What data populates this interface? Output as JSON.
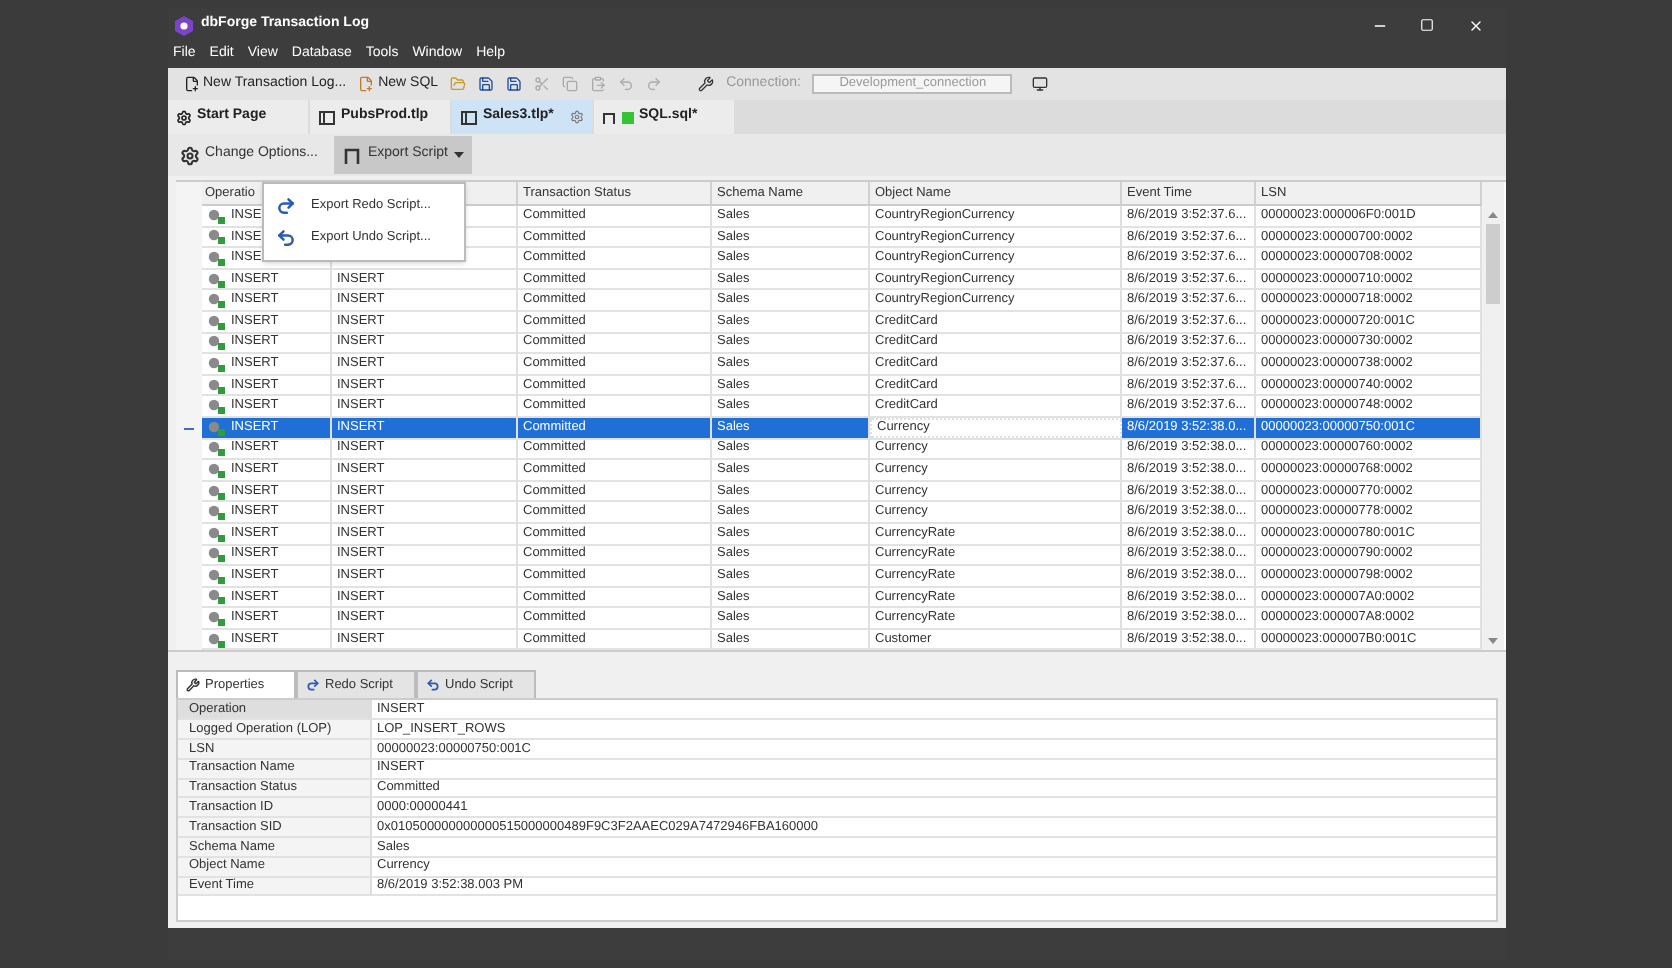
{
  "window": {
    "title": "dbForge Transaction Log"
  },
  "menu": [
    "File",
    "Edit",
    "View",
    "Database",
    "Tools",
    "Window",
    "Help"
  ],
  "toolbar": {
    "new_log": "New Transaction Log...",
    "new_sql": "New SQL",
    "connection_label": "Connection:",
    "connection_value": "Development_connection"
  },
  "document_tabs": [
    {
      "label": "Start Page",
      "kind": "start",
      "selected": false
    },
    {
      "label": "PubsProd.tlp",
      "kind": "log",
      "selected": false
    },
    {
      "label": "Sales3.tlp*",
      "kind": "log",
      "selected": true
    },
    {
      "label": "SQL.sql*",
      "kind": "sql",
      "selected": false
    }
  ],
  "log_toolbar": {
    "change_options": "Change Options...",
    "export_script": "Export Script",
    "export_open": true
  },
  "export_menu": [
    {
      "label": "Export Redo Script...",
      "kind": "redo"
    },
    {
      "label": "Export Undo Script...",
      "kind": "undo"
    }
  ],
  "columns": [
    "Operatio",
    "Transaction Status",
    "Schema Name",
    "Object Name",
    "Event Time",
    "LSN"
  ],
  "rows": [
    {
      "operation": "INSE",
      "status": "Committed",
      "schema": "Sales",
      "object": "CountryRegionCurrency",
      "time": "8/6/2019 3:52:37.6...",
      "lsn": "00000023:000006F0:001D",
      "selected": false
    },
    {
      "operation": "INSE",
      "status": "Committed",
      "schema": "Sales",
      "object": "CountryRegionCurrency",
      "time": "8/6/2019 3:52:37.6...",
      "lsn": "00000023:00000700:0002",
      "selected": false
    },
    {
      "operation": "INSE",
      "status": "Committed",
      "schema": "Sales",
      "object": "CountryRegionCurrency",
      "time": "8/6/2019 3:52:37.6...",
      "lsn": "00000023:00000708:0002",
      "selected": false
    },
    {
      "operation": "INSERT",
      "column_2": "INSERT",
      "status": "Committed",
      "schema": "Sales",
      "object": "CountryRegionCurrency",
      "time": "8/6/2019 3:52:37.6...",
      "lsn": "00000023:00000710:0002",
      "selected": false
    },
    {
      "operation": "INSERT",
      "column_2": "INSERT",
      "status": "Committed",
      "schema": "Sales",
      "object": "CountryRegionCurrency",
      "time": "8/6/2019 3:52:37.6...",
      "lsn": "00000023:00000718:0002",
      "selected": false
    },
    {
      "operation": "INSERT",
      "column_2": "INSERT",
      "status": "Committed",
      "schema": "Sales",
      "object": "CreditCard",
      "time": "8/6/2019 3:52:37.6...",
      "lsn": "00000023:00000720:001C",
      "selected": false
    },
    {
      "operation": "INSERT",
      "column_2": "INSERT",
      "status": "Committed",
      "schema": "Sales",
      "object": "CreditCard",
      "time": "8/6/2019 3:52:37.6...",
      "lsn": "00000023:00000730:0002",
      "selected": false
    },
    {
      "operation": "INSERT",
      "column_2": "INSERT",
      "status": "Committed",
      "schema": "Sales",
      "object": "CreditCard",
      "time": "8/6/2019 3:52:37.6...",
      "lsn": "00000023:00000738:0002",
      "selected": false
    },
    {
      "operation": "INSERT",
      "column_2": "INSERT",
      "status": "Committed",
      "schema": "Sales",
      "object": "CreditCard",
      "time": "8/6/2019 3:52:37.6...",
      "lsn": "00000023:00000740:0002",
      "selected": false
    },
    {
      "operation": "INSERT",
      "column_2": "INSERT",
      "status": "Committed",
      "schema": "Sales",
      "object": "CreditCard",
      "time": "8/6/2019 3:52:37.6...",
      "lsn": "00000023:00000748:0002",
      "selected": false
    },
    {
      "operation": "INSERT",
      "column_2": "INSERT",
      "status": "Committed",
      "schema": "Sales",
      "object": "Currency",
      "time": "8/6/2019 3:52:38.0...",
      "lsn": "00000023:00000750:001C",
      "selected": true
    },
    {
      "operation": "INSERT",
      "column_2": "INSERT",
      "status": "Committed",
      "schema": "Sales",
      "object": "Currency",
      "time": "8/6/2019 3:52:38.0...",
      "lsn": "00000023:00000760:0002",
      "selected": false
    },
    {
      "operation": "INSERT",
      "column_2": "INSERT",
      "status": "Committed",
      "schema": "Sales",
      "object": "Currency",
      "time": "8/6/2019 3:52:38.0...",
      "lsn": "00000023:00000768:0002",
      "selected": false
    },
    {
      "operation": "INSERT",
      "column_2": "INSERT",
      "status": "Committed",
      "schema": "Sales",
      "object": "Currency",
      "time": "8/6/2019 3:52:38.0...",
      "lsn": "00000023:00000770:0002",
      "selected": false
    },
    {
      "operation": "INSERT",
      "column_2": "INSERT",
      "status": "Committed",
      "schema": "Sales",
      "object": "Currency",
      "time": "8/6/2019 3:52:38.0...",
      "lsn": "00000023:00000778:0002",
      "selected": false
    },
    {
      "operation": "INSERT",
      "column_2": "INSERT",
      "status": "Committed",
      "schema": "Sales",
      "object": "CurrencyRate",
      "time": "8/6/2019 3:52:38.0...",
      "lsn": "00000023:00000780:001C",
      "selected": false
    },
    {
      "operation": "INSERT",
      "column_2": "INSERT",
      "status": "Committed",
      "schema": "Sales",
      "object": "CurrencyRate",
      "time": "8/6/2019 3:52:38.0...",
      "lsn": "00000023:00000790:0002",
      "selected": false
    },
    {
      "operation": "INSERT",
      "column_2": "INSERT",
      "status": "Committed",
      "schema": "Sales",
      "object": "CurrencyRate",
      "time": "8/6/2019 3:52:38.0...",
      "lsn": "00000023:00000798:0002",
      "selected": false
    },
    {
      "operation": "INSERT",
      "column_2": "INSERT",
      "status": "Committed",
      "schema": "Sales",
      "object": "CurrencyRate",
      "time": "8/6/2019 3:52:38.0...",
      "lsn": "00000023:000007A0:0002",
      "selected": false
    },
    {
      "operation": "INSERT",
      "column_2": "INSERT",
      "status": "Committed",
      "schema": "Sales",
      "object": "CurrencyRate",
      "time": "8/6/2019 3:52:38.0...",
      "lsn": "00000023:000007A8:0002",
      "selected": false
    },
    {
      "operation": "INSERT",
      "column_2": "INSERT",
      "status": "Committed",
      "schema": "Sales",
      "object": "Customer",
      "time": "8/6/2019 3:52:38.0...",
      "lsn": "00000023:000007B0:001C",
      "selected": false
    }
  ],
  "detail_tabs": [
    {
      "label": "Properties",
      "kind": "properties",
      "selected": true
    },
    {
      "label": "Redo Script",
      "kind": "redo",
      "selected": false
    },
    {
      "label": "Undo Script",
      "kind": "undo",
      "selected": false
    }
  ],
  "properties": [
    {
      "name": "Operation",
      "value": "INSERT",
      "selected": true
    },
    {
      "name": "Logged Operation (LOP)",
      "value": "LOP_INSERT_ROWS",
      "selected": false
    },
    {
      "name": "LSN",
      "value": "00000023:00000750:001C",
      "selected": false
    },
    {
      "name": "Transaction Name",
      "value": "INSERT",
      "selected": false
    },
    {
      "name": "Transaction Status",
      "value": "Committed",
      "selected": false
    },
    {
      "name": "Transaction ID",
      "value": "0000:00000441",
      "selected": false
    },
    {
      "name": "Transaction SID",
      "value": "0x010500000000000515000000489F9C3F2AAEC029A7472946FBA160000",
      "selected": false
    },
    {
      "name": "Schema Name",
      "value": "Sales",
      "selected": false
    },
    {
      "name": "Object Name",
      "value": "Currency",
      "selected": false
    },
    {
      "name": "Event Time",
      "value": "8/6/2019 3:52:38.003 PM",
      "selected": false
    }
  ]
}
